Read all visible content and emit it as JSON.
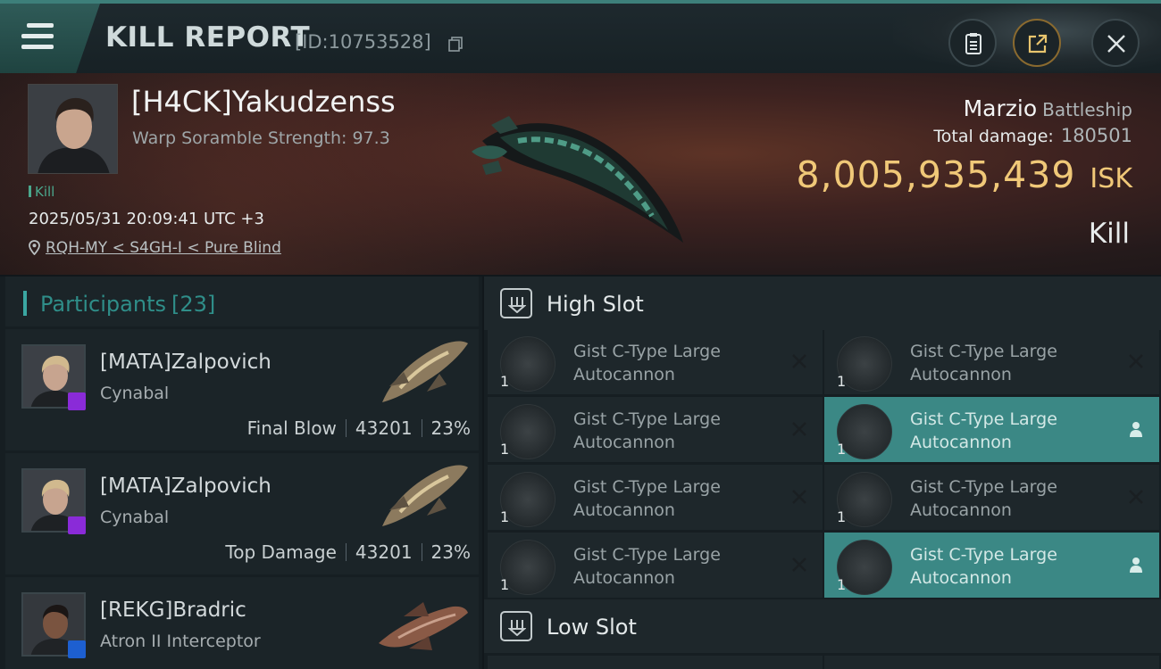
{
  "header": {
    "title": "KILL REPORT",
    "report_id": "[ID:10753528]"
  },
  "victim": {
    "name": "[H4CK]Yakudzenss",
    "stat": "Warp Soramble Strength: 97.3",
    "tag": "Kill",
    "timestamp": "2025/05/31 20:09:41 UTC +3",
    "location": "RQH-MY < S4GH-I < Pure Blind",
    "ship_name": "Marzio",
    "ship_class": "Battleship",
    "total_damage_label": "Total damage:",
    "total_damage": "180501",
    "isk_value": "8,005,935,439",
    "isk_unit": "ISK",
    "kill_type": "Kill"
  },
  "participants": {
    "title": "Participants",
    "count": "[23]",
    "items": [
      {
        "name": "[MATA]Zalpovich",
        "ship": "Cynabal",
        "role": "Final Blow",
        "damage": "43201",
        "percent": "23%",
        "badge": "purple",
        "portrait": "blond-pilot"
      },
      {
        "name": "[MATA]Zalpovich",
        "ship": "Cynabal",
        "role": "Top Damage",
        "damage": "43201",
        "percent": "23%",
        "badge": "purple",
        "portrait": "blond-pilot"
      },
      {
        "name": "[REKG]Bradric",
        "ship": "Atron II Interceptor",
        "role": "",
        "damage": "",
        "percent": "",
        "badge": "blue",
        "portrait": "dark-haired-pilot"
      }
    ]
  },
  "slots": {
    "high": {
      "title": "High Slot",
      "modules": [
        {
          "name": "Gist C-Type Large Autocannon",
          "qty": "1",
          "state": "destroyed",
          "icon": "autocannon-icon"
        },
        {
          "name": "Gist C-Type Large Autocannon",
          "qty": "1",
          "state": "destroyed",
          "icon": "autocannon-icon"
        },
        {
          "name": "Gist C-Type Large Autocannon",
          "qty": "1",
          "state": "destroyed",
          "icon": "autocannon-icon"
        },
        {
          "name": "Gist C-Type Large Autocannon",
          "qty": "1",
          "state": "dropped",
          "icon": "autocannon-icon"
        },
        {
          "name": "Gist C-Type Large Autocannon",
          "qty": "1",
          "state": "destroyed",
          "icon": "autocannon-icon"
        },
        {
          "name": "Gist C-Type Large Autocannon",
          "qty": "1",
          "state": "destroyed",
          "icon": "autocannon-icon"
        },
        {
          "name": "Gist C-Type Large Autocannon",
          "qty": "1",
          "state": "destroyed",
          "icon": "autocannon-icon"
        },
        {
          "name": "Gist C-Type Large Autocannon",
          "qty": "1",
          "state": "dropped",
          "icon": "autocannon-icon"
        }
      ]
    },
    "low": {
      "title": "Low Slot"
    }
  },
  "colors": {
    "accent": "#3b8885",
    "isk": "#f0c878",
    "kill_tag": "#4aa88d",
    "badge_purple": "#8a2bd8",
    "badge_blue": "#1d5fd0"
  }
}
